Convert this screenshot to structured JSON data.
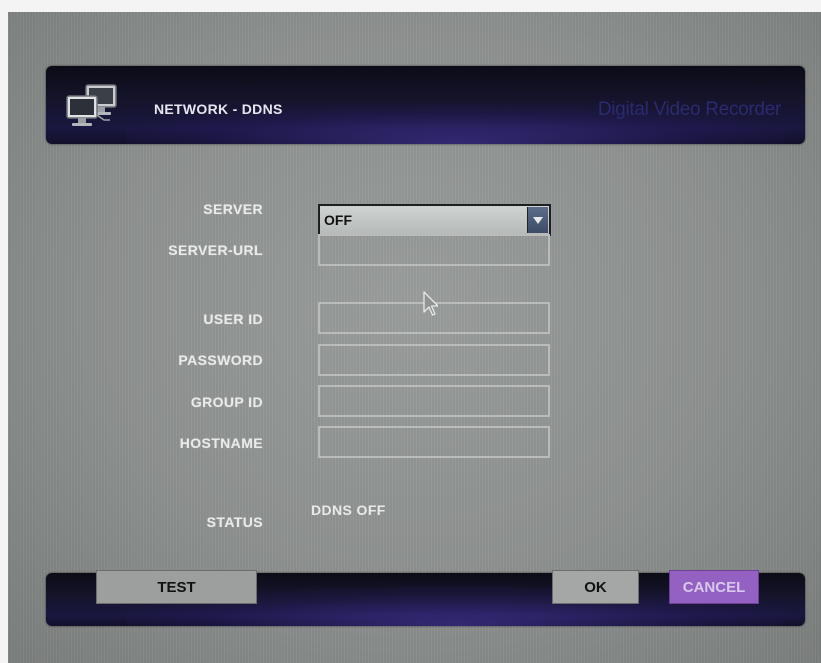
{
  "header": {
    "title": "NETWORK - DDNS",
    "brand": "Digital Video Recorder",
    "icon": "network-computers-icon"
  },
  "form": {
    "server": {
      "label": "SERVER",
      "value": "OFF"
    },
    "server_url": {
      "label": "SERVER-URL",
      "value": ""
    },
    "user_id": {
      "label": "USER ID",
      "value": ""
    },
    "password": {
      "label": "PASSWORD",
      "value": ""
    },
    "group_id": {
      "label": "GROUP ID",
      "value": ""
    },
    "hostname": {
      "label": "HOSTNAME",
      "value": ""
    },
    "status": {
      "label": "STATUS",
      "value": "DDNS OFF"
    }
  },
  "footer": {
    "test_label": "TEST",
    "ok_label": "OK",
    "cancel_label": "CANCEL"
  },
  "colors": {
    "bar": "#15142c",
    "cancel_accent": "#9361c2",
    "background": "#8d918f"
  }
}
